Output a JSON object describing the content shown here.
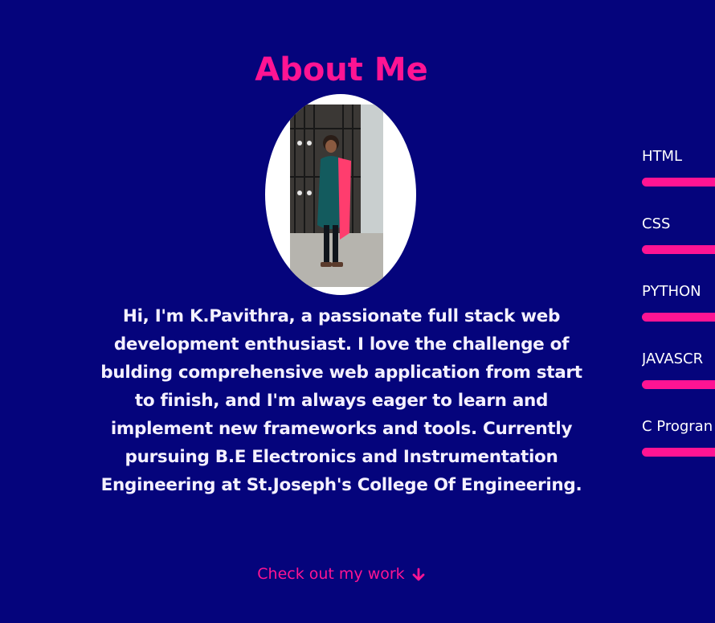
{
  "about": {
    "title": "About Me",
    "photo_alt": "Photo of K.Pavithra",
    "bio": "Hi, I'm K.Pavithra, a passionate full stack web development enthusiast. I love the challenge of bulding comprehensive web application from start to finish, and I'm always eager to learn and implement new frameworks and tools. Currently pursuing B.E Electronics and Instrumentation Engineering at St.Joseph's College Of Engineering.",
    "cta_label": "Check out my work",
    "cta_icon": "arrow-down-icon"
  },
  "skills": [
    {
      "label": "HTML"
    },
    {
      "label": "CSS"
    },
    {
      "label": "PYTHON"
    },
    {
      "label": "JAVASCR"
    },
    {
      "label": "C Progran"
    }
  ],
  "colors": {
    "background": "#05047c",
    "accent": "#ff1493",
    "text": "#f4f0ff"
  }
}
